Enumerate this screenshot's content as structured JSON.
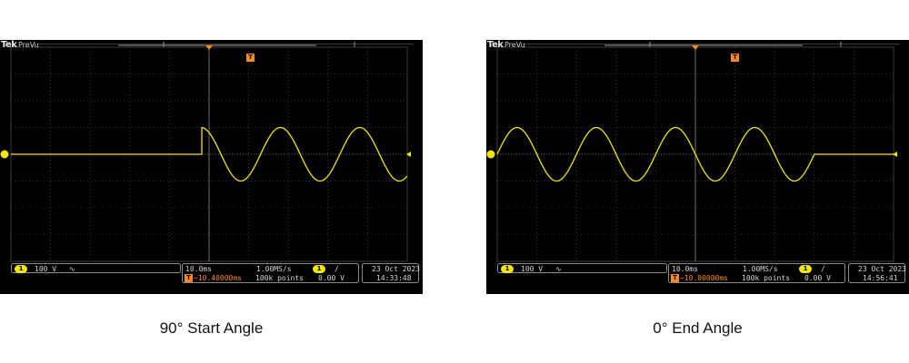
{
  "captures": [
    {
      "brand": "Tek",
      "mode": "PreVu",
      "channel": "1",
      "volts_per_div": "100 V",
      "coupling_symbol": "∿",
      "time_per_div": "10.0ms",
      "sample_rate": "1.00MS/s",
      "trigger_symbol": "T",
      "trigger_delay": "−10.40000ms",
      "record_length": "100k points",
      "trigger_channel": "1",
      "trigger_slope": "/",
      "trigger_level": "0.00 V",
      "date": "23 Oct 2023",
      "time": "14:33:48",
      "caption": "90° Start Angle",
      "waveform": {
        "start_phase_deg": 90,
        "active_from_div": 4.8,
        "active_to_div": 10,
        "cycles_per_div": 0.5,
        "amplitude_div": 1
      }
    },
    {
      "brand": "Tek",
      "mode": "PreVu",
      "channel": "1",
      "volts_per_div": "100 V",
      "coupling_symbol": "∿",
      "time_per_div": "10.0ms",
      "sample_rate": "1.00MS/s",
      "trigger_symbol": "T",
      "trigger_delay": "−10.00000ms",
      "record_length": "100k points",
      "trigger_channel": "1",
      "trigger_slope": "/",
      "trigger_level": "0.00 V",
      "date": "23 Oct 2023",
      "time": "14:56:41",
      "caption": "0° End Angle",
      "waveform": {
        "start_phase_deg": 0,
        "active_from_div": 0,
        "active_to_div": 8,
        "cycles_per_div": 0.5,
        "amplitude_div": 1
      }
    }
  ],
  "colors": {
    "trace": "#f2e40f",
    "trigger": "#ff8a1f",
    "grid": "#5a5a5a",
    "frame": "#8a8a8a"
  }
}
